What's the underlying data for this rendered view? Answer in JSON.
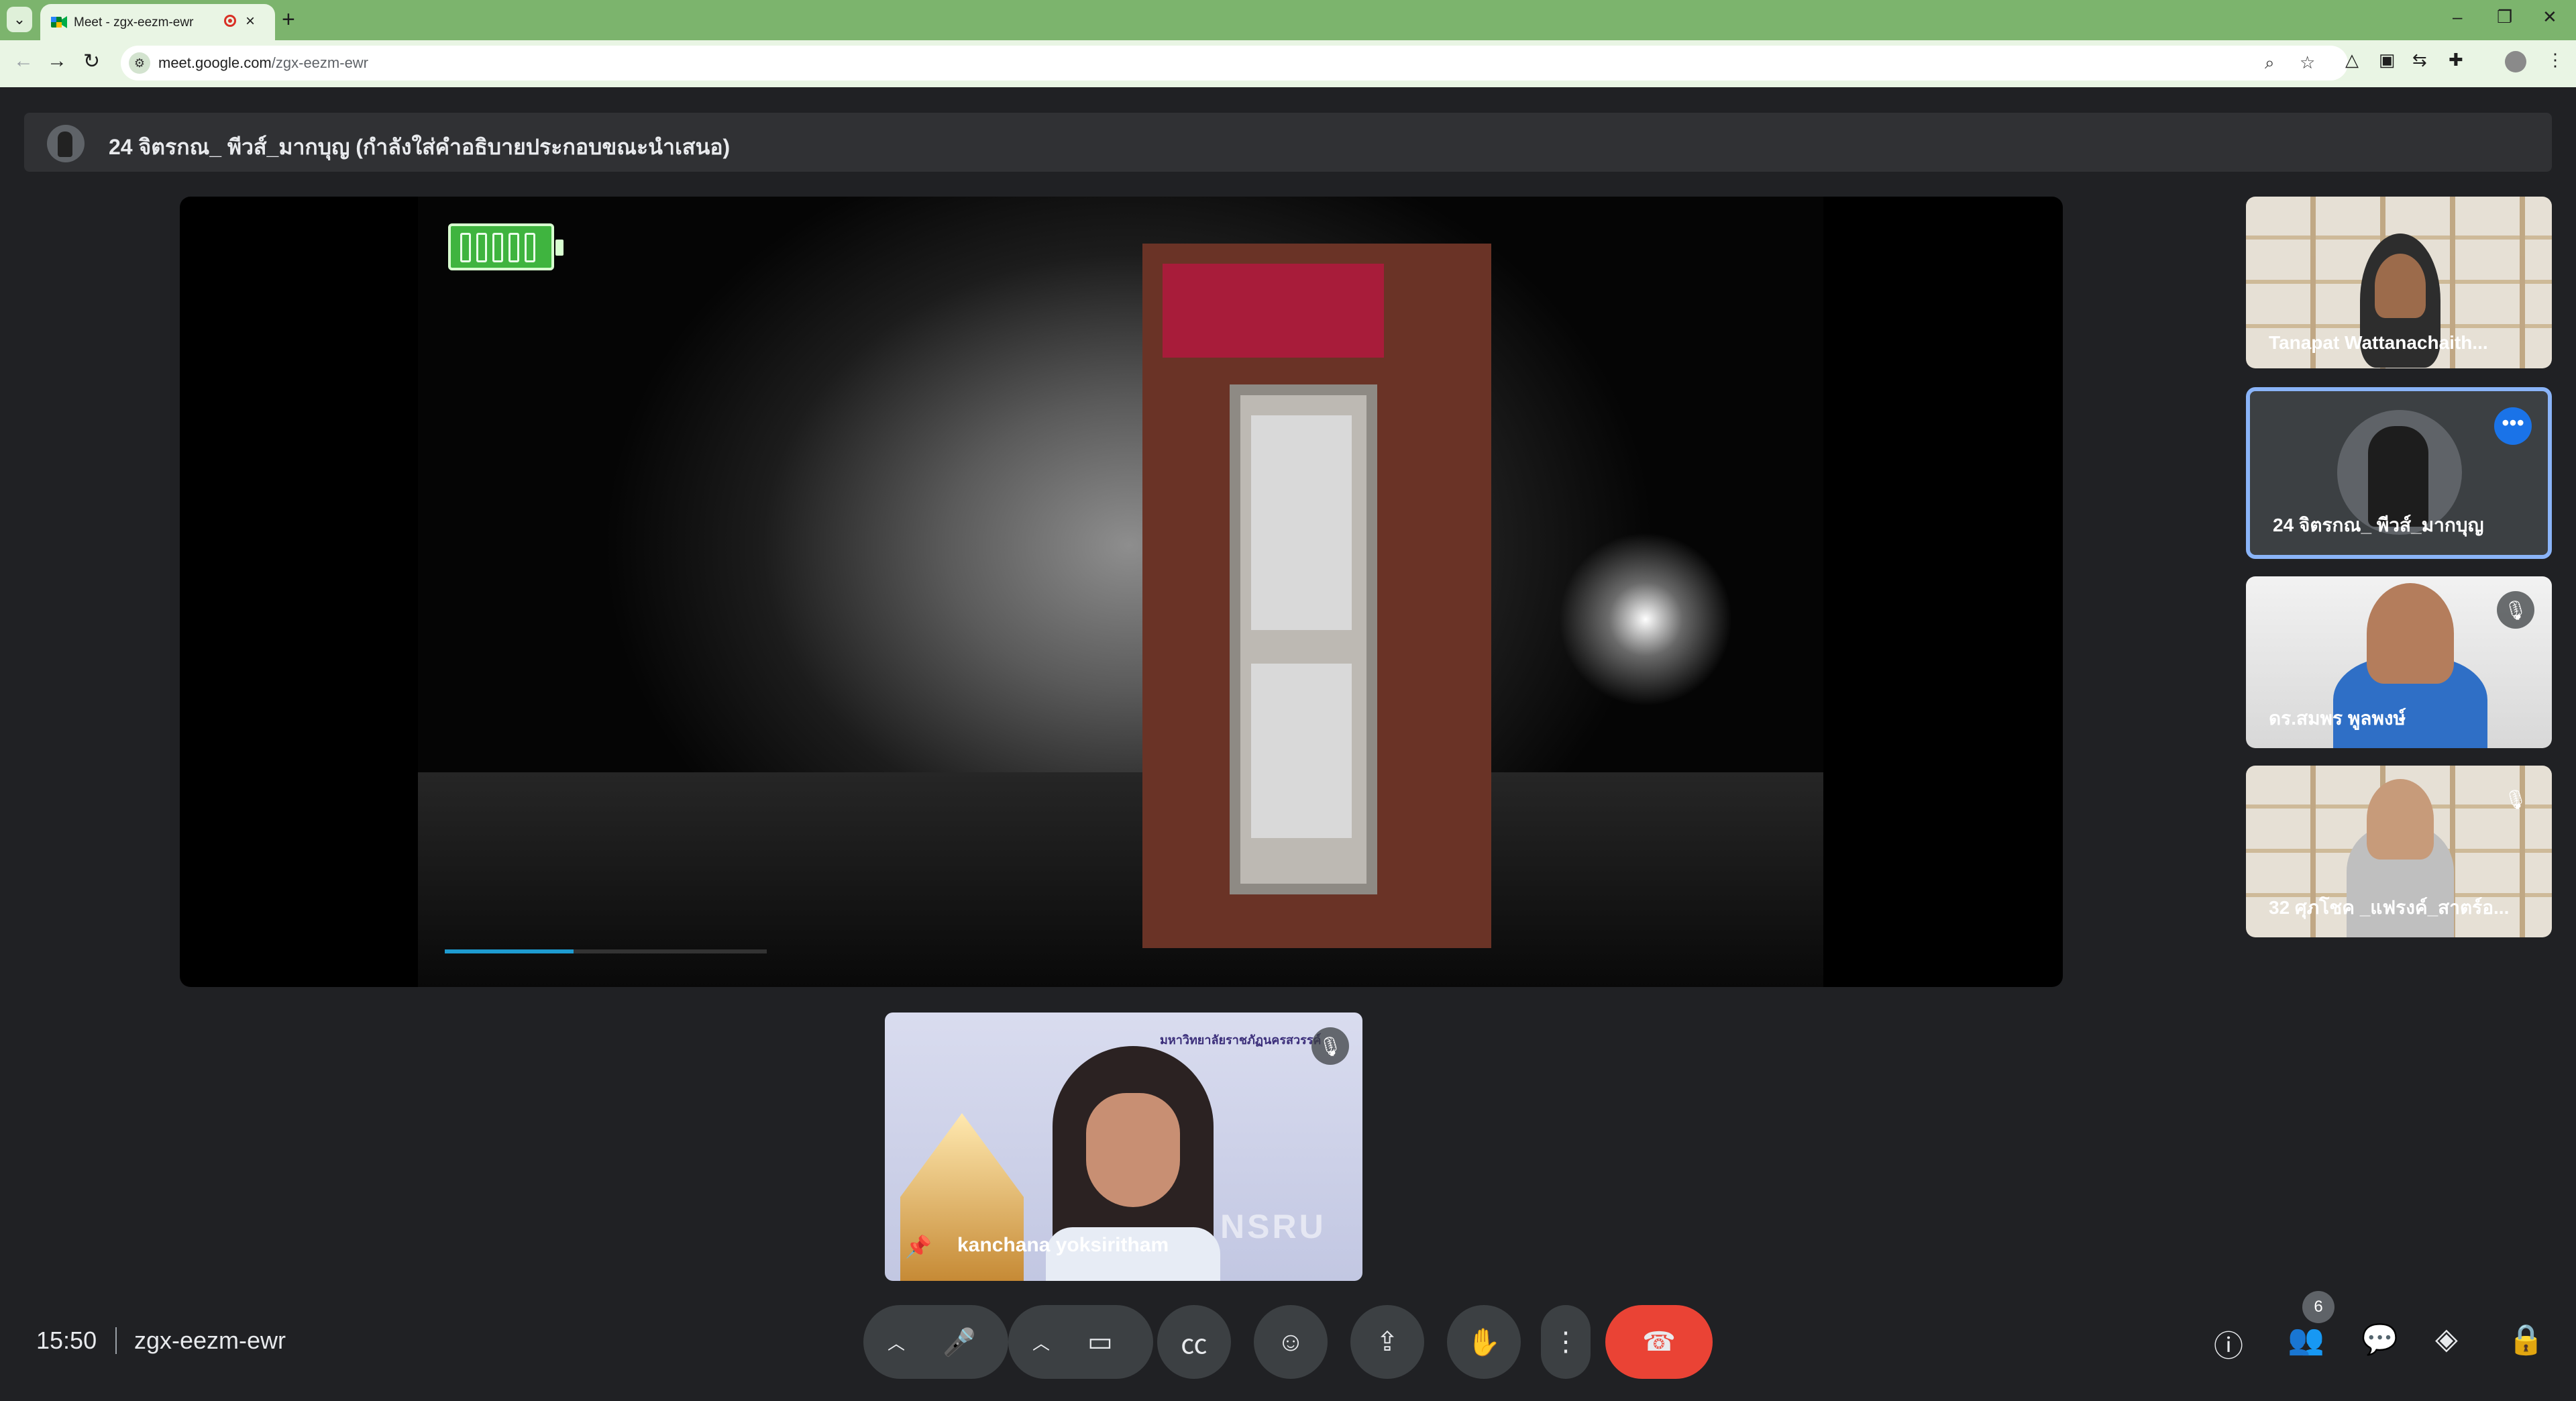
{
  "browser": {
    "tab_title": "Meet - zgx-eezm-ewr",
    "new_tab": "+",
    "url_host": "meet.google.com",
    "url_path": "/zgx-eezm-ewr",
    "window_controls": {
      "minimize": "–",
      "restore": "❐",
      "close": "✕"
    },
    "nav": {
      "back": "←",
      "forward": "→",
      "reload": "↻"
    }
  },
  "presentation": {
    "banner_text": "24 จิตรกณ_ พีวส์_มากบุญ (กำลังใส่คำอธิบายประกอบขณะนำเสนอ)",
    "progress_fraction": 0.4,
    "battery_cells": 5
  },
  "participants": [
    {
      "name": "Tanapat Wattanachaith...",
      "muted": false
    },
    {
      "name": "24 จิตรกณ_ พีวส์_มากบุญ",
      "muted": false,
      "active": true
    },
    {
      "name": "ดร.สมพร พูลพงษ์",
      "muted": true
    },
    {
      "name": "32 ศุภโชค _แฟรงค์_สาตร์อ...",
      "muted": true
    }
  ],
  "self_view": {
    "name": "kanchana yoksiritham",
    "watermark": "NSRU",
    "logo_text": "มหาวิทยาลัยราชภัฏนครสวรรค์"
  },
  "bottom_bar": {
    "time": "15:50",
    "meeting_code": "zgx-eezm-ewr",
    "people_count": "6"
  },
  "colors": {
    "tabbar": "#7cb46d",
    "meet_bg": "#202124",
    "end_call": "#ea4335",
    "active_tile": "#8ab4f8"
  }
}
